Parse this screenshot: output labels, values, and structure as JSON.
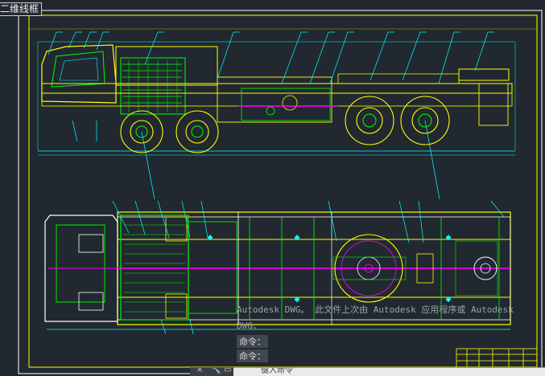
{
  "viewport": {
    "label": "二维线框"
  },
  "command_area": {
    "history": [
      "Autodesk DWG。  此文件上次由 Autodesk 应用程序或 Autodesk",
      "DWG。",
      "命令：",
      "命令："
    ],
    "input_placeholder": "键入命令",
    "buttons": [
      "×",
      "🔧",
      "▭"
    ]
  },
  "colors": {
    "background": "#212830",
    "frame": "#ffff00",
    "leader": "#00ffff",
    "detail": "#00ff00",
    "accent": "#ff00ff",
    "white": "#ffffff"
  }
}
